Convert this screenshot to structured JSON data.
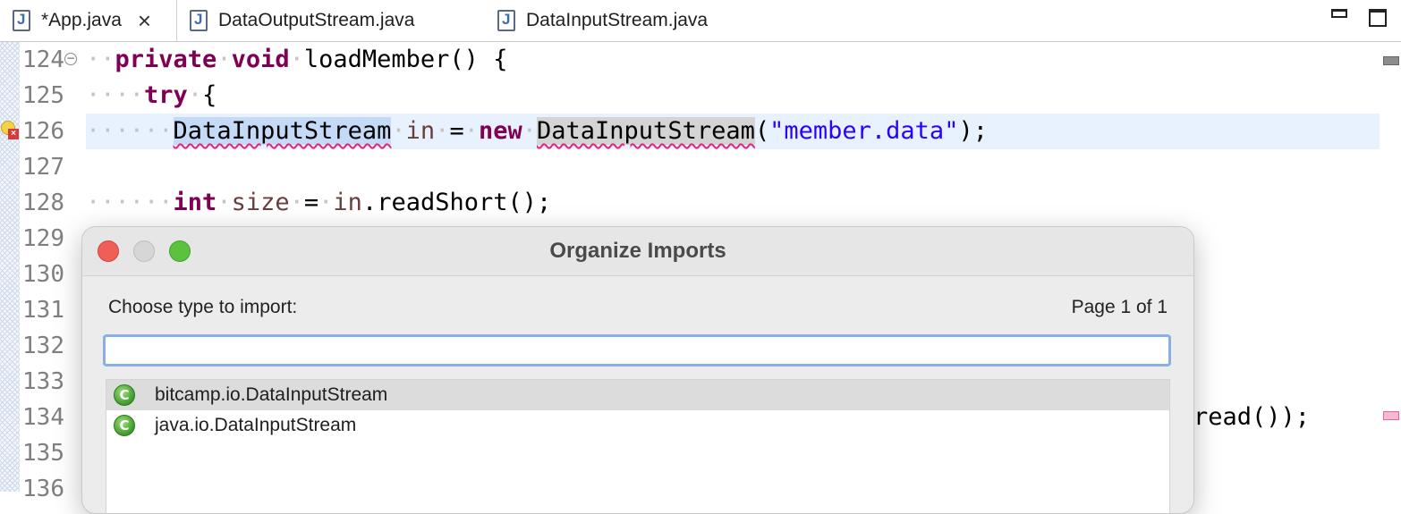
{
  "tabs": [
    {
      "label": "*App.java",
      "active": true,
      "closable": true
    },
    {
      "label": "DataOutputStream.java",
      "active": false
    },
    {
      "label": "DataInputStream.java",
      "active": false
    }
  ],
  "editor": {
    "line_numbers": [
      "124",
      "125",
      "126",
      "127",
      "128",
      "129",
      "130",
      "131",
      "132",
      "133",
      "134",
      "135",
      "136"
    ],
    "code": {
      "l124": {
        "ws": "··",
        "kw1": "private",
        "kw2": "void",
        "rest": "loadMember() {"
      },
      "l125": {
        "ws": "····",
        "kw": "try",
        "rest": "{"
      },
      "l126": {
        "ws": "······",
        "type1": "DataInputStream",
        "var": "in",
        "eq": "=",
        "kw": "new",
        "type2": "DataInputStream",
        "open": "(",
        "str": "\"member.data\"",
        "close": ");"
      },
      "l128": {
        "ws": "······",
        "kw": "int",
        "var": "size",
        "eq": "=",
        "ref": "in",
        "rest": ".readShort();"
      },
      "l134_tail": "read());"
    }
  },
  "dialog": {
    "title": "Organize Imports",
    "prompt": "Choose type to import:",
    "page": "Page 1 of 1",
    "filter_value": "",
    "types": [
      {
        "label": "bitcamp.io.DataInputStream",
        "selected": true
      },
      {
        "label": "java.io.DataInputStream",
        "selected": false
      }
    ]
  }
}
